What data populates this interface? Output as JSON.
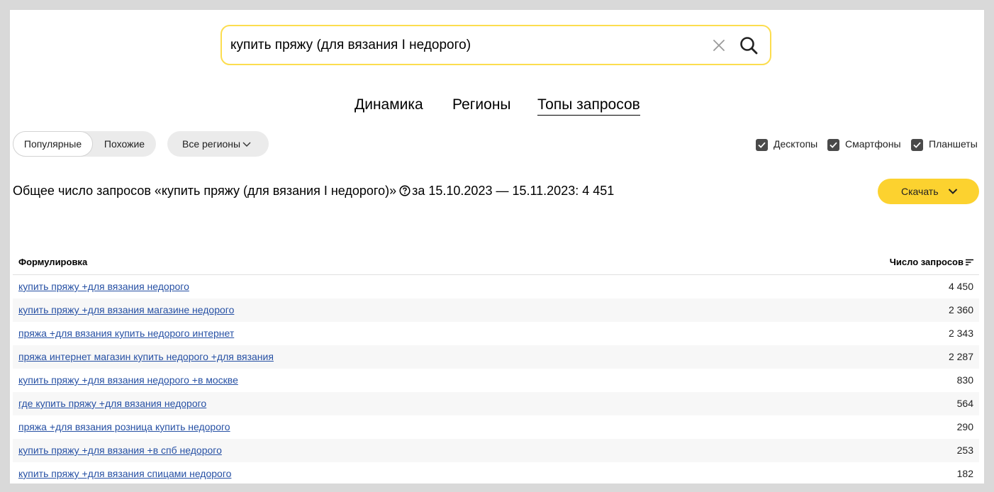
{
  "search": {
    "value": "купить пряжу (для вязания I недорого)"
  },
  "tabs": [
    {
      "label": "Динамика"
    },
    {
      "label": "Регионы"
    },
    {
      "label": "Топы запросов"
    }
  ],
  "filters": {
    "popular_label": "Популярные",
    "similar_label": "Похожие",
    "region_label": "Все регионы",
    "devices": [
      {
        "label": "Десктопы",
        "checked": true
      },
      {
        "label": "Смартфоны",
        "checked": true
      },
      {
        "label": "Планшеты",
        "checked": true
      }
    ]
  },
  "summary": {
    "prefix": "Общее число запросов «купить пряжу (для вязания I недорого)»",
    "suffix": "за 15.10.2023 — 15.11.2023: 4 451"
  },
  "download_label": "Скачать",
  "table": {
    "col_phrase": "Формулировка",
    "col_count": "Число запросов",
    "rows": [
      {
        "phrase": "купить пряжу +для вязания недорого",
        "count": "4 450"
      },
      {
        "phrase": "купить пряжу +для вязания магазине недорого",
        "count": "2 360"
      },
      {
        "phrase": "пряжа +для вязания купить недорого интернет",
        "count": "2 343"
      },
      {
        "phrase": "пряжа интернет магазин купить недорого +для вязания",
        "count": "2 287"
      },
      {
        "phrase": "купить пряжу +для вязания недорого +в москве",
        "count": "830"
      },
      {
        "phrase": "где купить пряжу +для вязания недорого",
        "count": "564"
      },
      {
        "phrase": "пряжа +для вязания розница купить недорого",
        "count": "290"
      },
      {
        "phrase": "купить пряжу +для вязания +в спб недорого",
        "count": "253"
      },
      {
        "phrase": "купить пряжу +для вязания спицами недорого",
        "count": "182"
      }
    ]
  },
  "colors": {
    "accent_yellow": "#fcd22f",
    "link_blue": "#2650a4",
    "search_border": "#fcdd4f"
  }
}
